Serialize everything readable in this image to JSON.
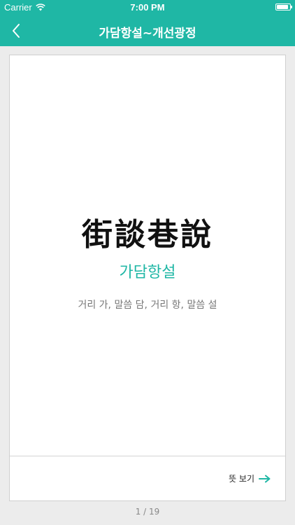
{
  "status_bar": {
    "carrier": "Carrier",
    "time": "7:00 PM",
    "wifi_icon": "wifi-icon",
    "battery_icon": "battery-icon",
    "battery_level": 0.9
  },
  "nav": {
    "back_icon": "chevron-left-icon",
    "title": "가담항설~개선광정"
  },
  "card": {
    "hanja": "街談巷說",
    "hangul": "가담항설",
    "meaning": "거리 가, 말씀 담, 거리 항, 말씀 설",
    "view_meaning_label": "뜻 보기",
    "view_meaning_icon": "arrow-right-icon"
  },
  "pager": {
    "text": "1 / 19"
  },
  "colors": {
    "accent": "#1fb7a5",
    "background": "#ececec",
    "card": "#ffffff"
  }
}
